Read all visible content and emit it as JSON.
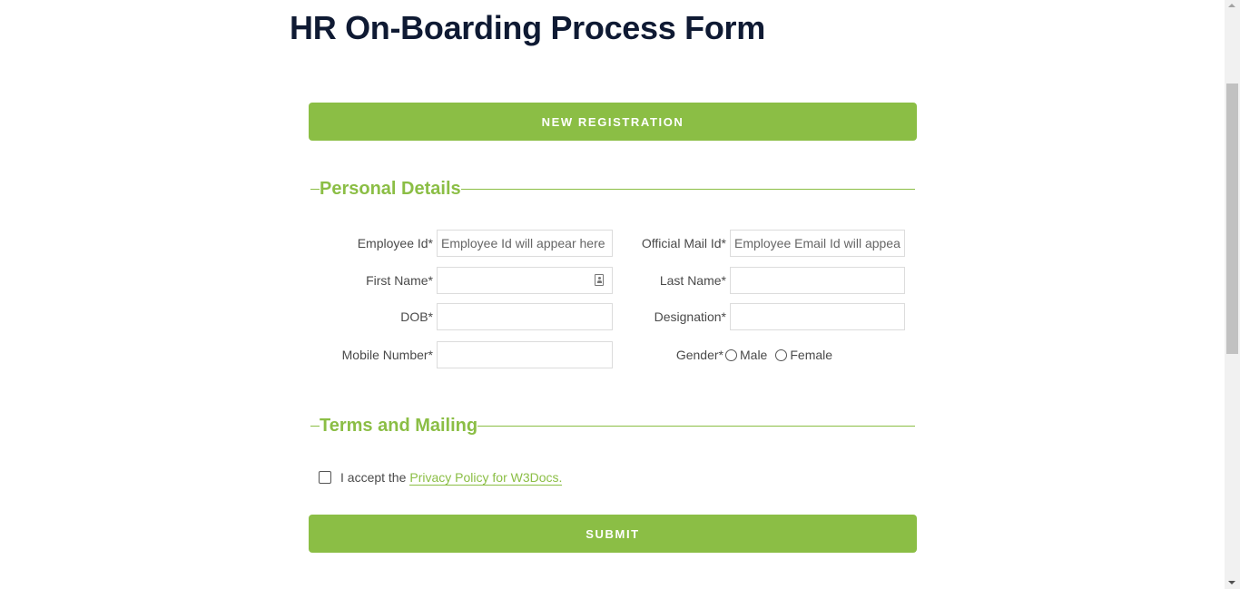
{
  "page": {
    "title": "HR On-Boarding Process Form"
  },
  "buttons": {
    "new_registration": "NEW REGISTRATION",
    "submit": "SUBMIT"
  },
  "sections": {
    "personal": "Personal Details",
    "terms": "Terms and Mailing"
  },
  "fields": {
    "employee_id": {
      "label": "Employee Id*",
      "value": "",
      "placeholder": "Employee Id will appear here"
    },
    "official_mail": {
      "label": "Official Mail Id*",
      "value": "",
      "placeholder": "Employee Email Id will appear here"
    },
    "first_name": {
      "label": "First Name*",
      "value": "",
      "placeholder": ""
    },
    "last_name": {
      "label": "Last Name*",
      "value": "",
      "placeholder": ""
    },
    "dob": {
      "label": "DOB*",
      "value": "",
      "placeholder": ""
    },
    "designation": {
      "label": "Designation*",
      "value": "",
      "placeholder": ""
    },
    "mobile": {
      "label": "Mobile Number*",
      "value": "",
      "placeholder": ""
    }
  },
  "gender": {
    "label": "Gender*",
    "options": [
      "Male",
      "Female"
    ],
    "selected": null
  },
  "terms": {
    "checked": false,
    "text": "I accept the",
    "link_text": "Privacy Policy for W3Docs."
  },
  "icons": {
    "contact": "contact-card-icon"
  },
  "colors": {
    "accent": "#8bbe45",
    "title": "#0f1a33",
    "text": "#4a4a4a"
  }
}
